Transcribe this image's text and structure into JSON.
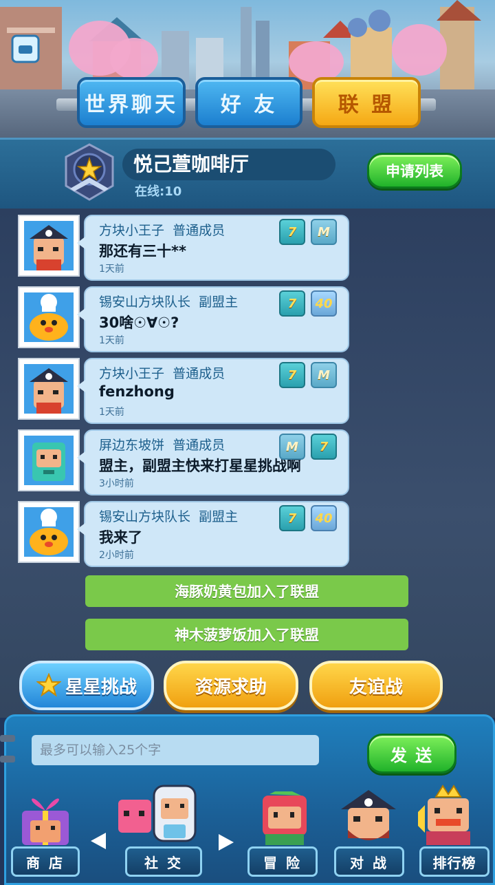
{
  "tabs": [
    {
      "label": "世界聊天",
      "active": false
    },
    {
      "label": "好 友",
      "active": false
    },
    {
      "label": "联 盟",
      "active": true
    }
  ],
  "guild": {
    "name": "悦己萱咖啡厅",
    "online": "在线:10",
    "apply_list_label": "申请列表"
  },
  "messages": [
    {
      "sender": "方块小王子",
      "role": "普通成员",
      "text": "那还有三十**",
      "time": "1天前",
      "badges": [
        "7",
        "M"
      ]
    },
    {
      "sender": "锡安山方块队长",
      "role": "副盟主",
      "text": "30啥☉∀☉?",
      "time": "1天前",
      "badges": [
        "7",
        "40"
      ]
    },
    {
      "sender": "方块小王子",
      "role": "普通成员",
      "text": "fenzhong",
      "time": "1天前",
      "badges": [
        "7",
        "M"
      ]
    },
    {
      "sender": "屏边东坡饼",
      "role": "普通成员",
      "text": "盟主，副盟主快来打星星挑战啊",
      "time": "3小时前",
      "badges": [
        "M",
        "7"
      ]
    },
    {
      "sender": "锡安山方块队长",
      "role": "副盟主",
      "text": "我来了",
      "time": "2小时前",
      "badges": [
        "7",
        "40"
      ]
    }
  ],
  "system_messages": [
    "海豚奶黄包加入了联盟",
    "神木菠萝饭加入了联盟"
  ],
  "actions": {
    "star_challenge": "星星挑战",
    "resource_help": "资源求助",
    "friendly_battle": "友谊战"
  },
  "input": {
    "placeholder": "最多可以输入25个字",
    "value": "",
    "send_label": "发 送"
  },
  "nav": {
    "shop": "商 店",
    "social": "社 交",
    "adventure": "冒 险",
    "battle": "对 战",
    "ranking": "排行榜"
  },
  "colors": {
    "tab_active": "#f5b51c",
    "tab_inactive": "#2a8fdd",
    "bubble": "#cfe7f8",
    "system_msg": "#7ac94a",
    "send_button": "#28b830"
  }
}
